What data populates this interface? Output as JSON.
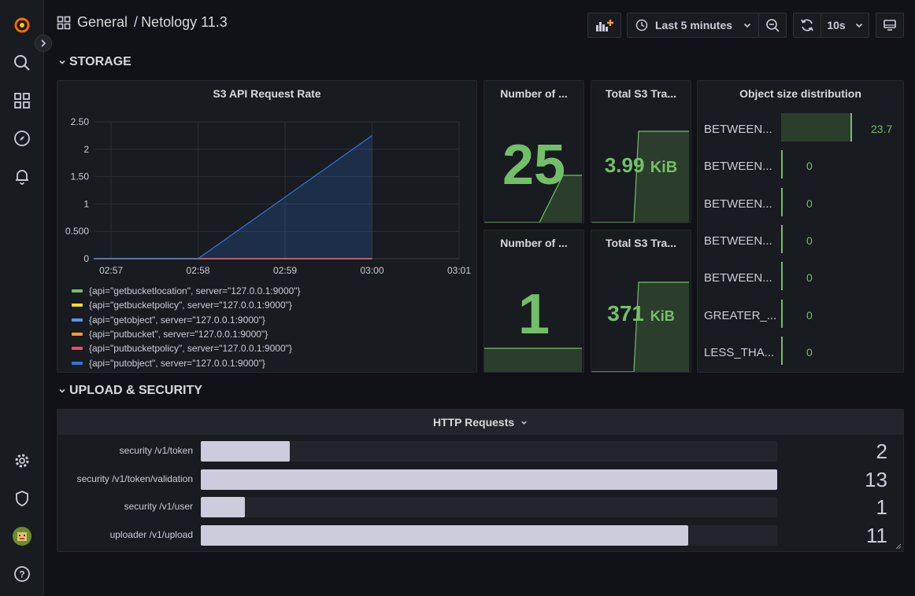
{
  "breadcrumb": {
    "folder": "General",
    "separator": "/",
    "dashboard": "Netology 11.3"
  },
  "time_picker": {
    "range_label": "Last 5 minutes",
    "refresh_interval": "10s"
  },
  "rows": {
    "storage": "STORAGE",
    "upload_security": "UPLOAD & SECURITY"
  },
  "panels": {
    "s3_rate": {
      "title": "S3 API Request Rate",
      "chart_data": {
        "type": "area",
        "x_ticks": [
          "02:57",
          "02:58",
          "02:59",
          "03:00",
          "03:01"
        ],
        "y_ticks": [
          "2.50",
          "2",
          "1.50",
          "1",
          "0.500",
          "0"
        ],
        "ylim": [
          0,
          2.5
        ],
        "series": [
          {
            "name": "{api=\"getbucketlocation\", server=\"127.0.0.1:9000\"}",
            "color": "#73bf69",
            "x": [
              "02:58",
              "03:00"
            ],
            "values": [
              0,
              0
            ]
          },
          {
            "name": "{api=\"getbucketpolicy\", server=\"127.0.0.1:9000\"}",
            "color": "#fade2a",
            "x": [
              "02:58",
              "03:00"
            ],
            "values": [
              0,
              0
            ]
          },
          {
            "name": "{api=\"getobject\", server=\"127.0.0.1:9000\"}",
            "color": "#5794f2",
            "x": [
              "02:58",
              "03:00"
            ],
            "values": [
              0,
              0
            ]
          },
          {
            "name": "{api=\"putbucket\", server=\"127.0.0.1:9000\"}",
            "color": "#ff9830",
            "x": [
              "02:58",
              "03:00"
            ],
            "values": [
              0,
              0
            ]
          },
          {
            "name": "{api=\"putbucketpolicy\", server=\"127.0.0.1:9000\"}",
            "color": "#f2495c",
            "x": [
              "02:58",
              "03:00"
            ],
            "values": [
              0,
              0
            ]
          },
          {
            "name": "{api=\"putobject\", server=\"127.0.0.1:9000\"}",
            "color": "#3274d9",
            "x": [
              "02:58",
              "03:00"
            ],
            "values": [
              0,
              2.25
            ]
          }
        ]
      }
    },
    "num_buckets": {
      "title": "Number of ...",
      "value": "25"
    },
    "num_objects": {
      "title": "Number of ...",
      "value": "1"
    },
    "total_s3_1": {
      "title": "Total S3 Tra...",
      "value": "3.99",
      "unit": "KiB"
    },
    "total_s3_2": {
      "title": "Total S3 Tra...",
      "value": "371",
      "unit": "KiB"
    },
    "obj_size": {
      "title": "Object size distribution",
      "items": [
        {
          "label": "BETWEEN...",
          "value": "23.7",
          "fraction": 1.0
        },
        {
          "label": "BETWEEN...",
          "value": "0",
          "fraction": 0
        },
        {
          "label": "BETWEEN...",
          "value": "0",
          "fraction": 0
        },
        {
          "label": "BETWEEN...",
          "value": "0",
          "fraction": 0
        },
        {
          "label": "BETWEEN...",
          "value": "0",
          "fraction": 0
        },
        {
          "label": "GREATER_...",
          "value": "0",
          "fraction": 0
        },
        {
          "label": "LESS_THA...",
          "value": "0",
          "fraction": 0
        }
      ]
    },
    "http_requests": {
      "title": "HTTP Requests",
      "max": 13,
      "items": [
        {
          "label": "security /v1/token",
          "value": 2
        },
        {
          "label": "security /v1/token/validation",
          "value": 13
        },
        {
          "label": "security /v1/user",
          "value": 1
        },
        {
          "label": "uploader /v1/upload",
          "value": 11
        }
      ]
    }
  },
  "colors": {
    "accent_green": "#73bf69",
    "bg": "#111217",
    "panel": "#181b1f",
    "series_blue": "#3274d9"
  }
}
